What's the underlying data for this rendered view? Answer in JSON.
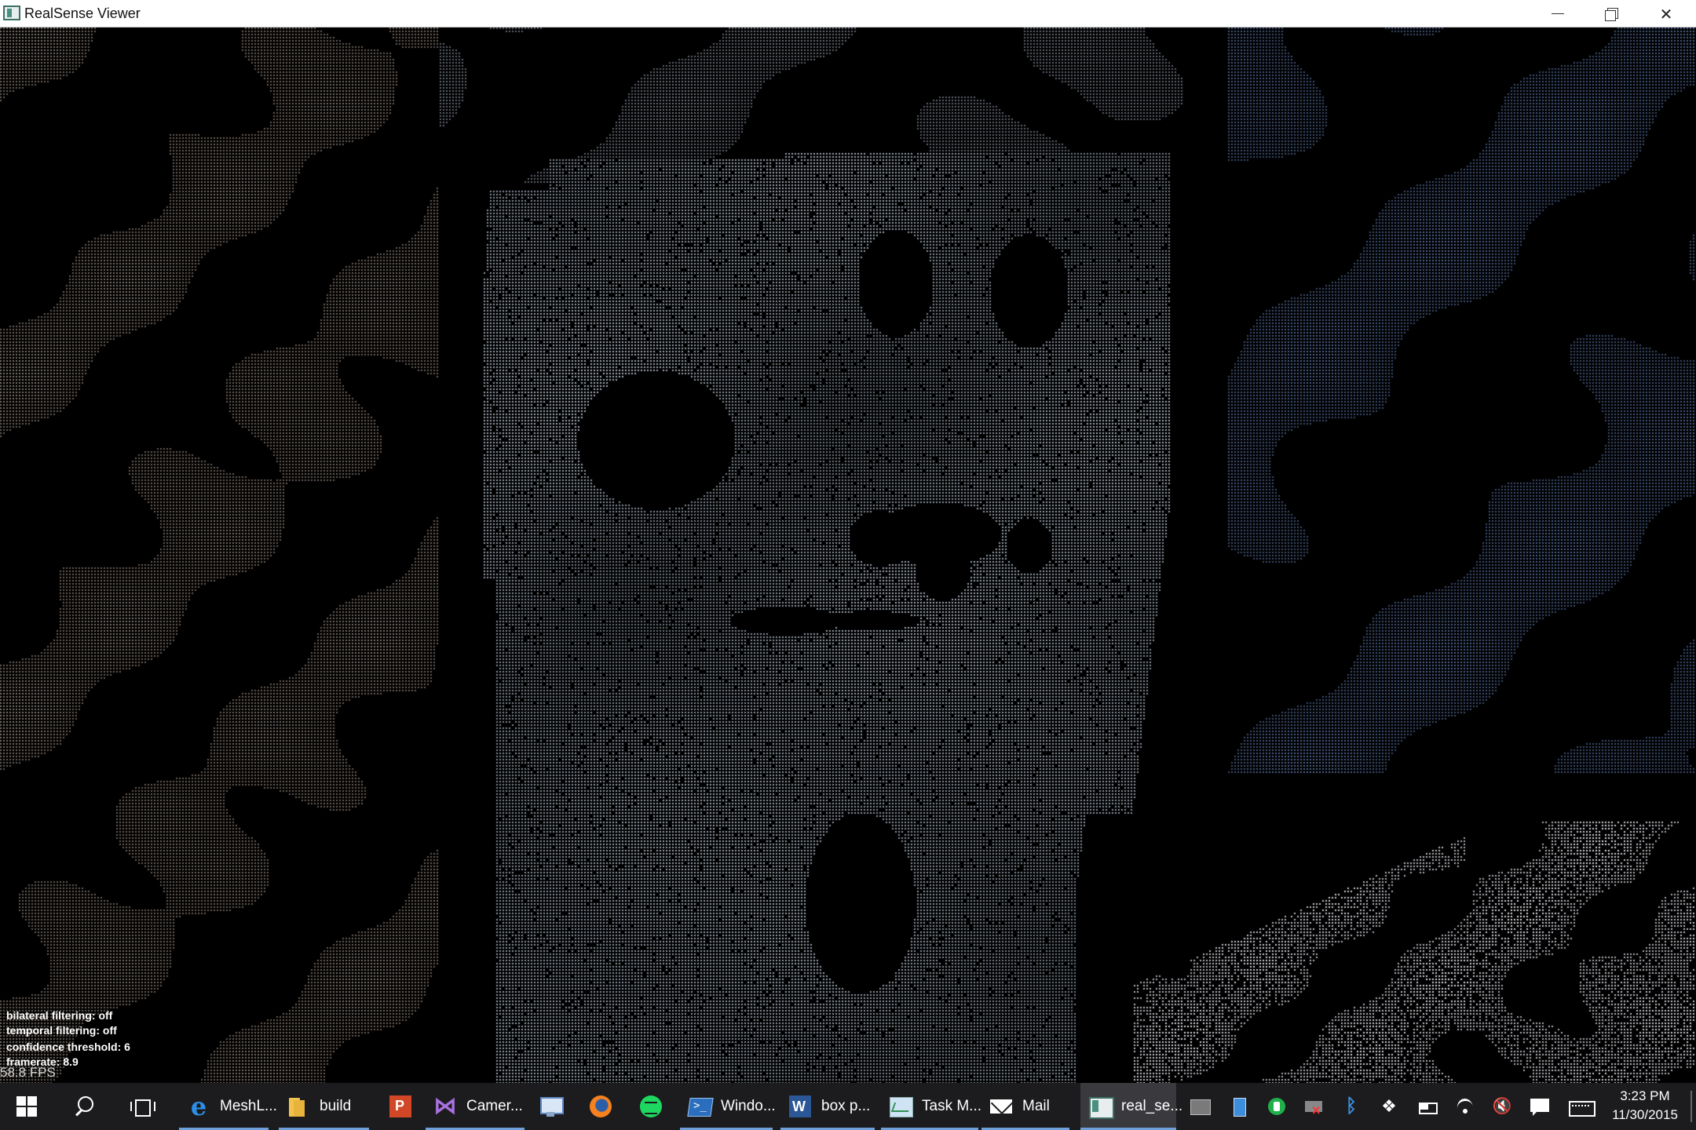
{
  "window": {
    "title": "RealSense Viewer",
    "controls": {
      "minimize": "minimize",
      "restore": "restore",
      "close": "close"
    }
  },
  "viewport": {
    "overlay_lines": [
      "bilateral filtering: off",
      "temporal filtering: off",
      "confidence threshold: 6",
      "framerate: 8.9"
    ],
    "fps": "58.8 FPS"
  },
  "taskbar": {
    "start_icon": "windows-logo-icon",
    "search_icon": "search-icon",
    "taskview_icon": "task-view-icon",
    "apps": [
      {
        "label": "MeshL...",
        "icon": "edge-icon",
        "running": true
      },
      {
        "label": "build",
        "icon": "folder-icon",
        "running": true
      },
      {
        "label": "",
        "icon": "powerpoint-icon",
        "running": false
      },
      {
        "label": "Camer...",
        "icon": "visual-studio-icon",
        "running": true
      },
      {
        "label": "",
        "icon": "remote-desktop-icon",
        "running": false
      },
      {
        "label": "",
        "icon": "firefox-icon",
        "running": false
      },
      {
        "label": "",
        "icon": "spotify-icon",
        "running": false
      },
      {
        "label": "Windo...",
        "icon": "powershell-icon",
        "running": true
      },
      {
        "label": "box p...",
        "icon": "word-icon",
        "running": true
      },
      {
        "label": "Task M...",
        "icon": "task-manager-icon",
        "running": true
      },
      {
        "label": "Mail",
        "icon": "mail-icon",
        "running": true
      },
      {
        "label": "real_se...",
        "icon": "realsense-icon",
        "running": true,
        "active": true
      }
    ],
    "tray_icons": [
      "tray-app-icon",
      "tray-display-icon",
      "tray-green-app-icon",
      "tray-network-error-icon",
      "bluetooth-icon",
      "dropbox-icon",
      "battery-icon",
      "wifi-icon",
      "volume-muted-icon",
      "action-center-icon",
      "keyboard-icon"
    ],
    "tray_glyphs": {
      "bluetooth": "ᛒ",
      "dropbox": "❖",
      "volume": "🔇"
    },
    "clock": {
      "time": "3:23 PM",
      "date": "11/30/2015"
    }
  }
}
